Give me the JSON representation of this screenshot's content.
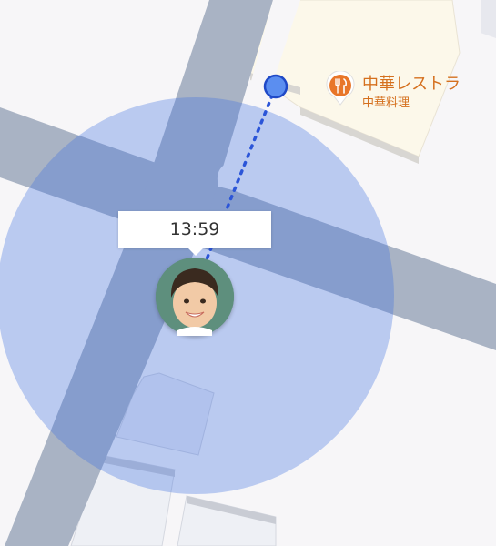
{
  "tracker": {
    "time": "13:59"
  },
  "poi": {
    "name": "中華レストラ",
    "category": "中華料理",
    "icon": "restaurant-icon",
    "color": "#e8762a"
  },
  "colors": {
    "accuracy_circle": "#3f6fe0",
    "location_dot": "#5b8ef0",
    "path": "#2b55d8",
    "road": "#a9b3c4",
    "poi_building": "#fcf8ea"
  }
}
